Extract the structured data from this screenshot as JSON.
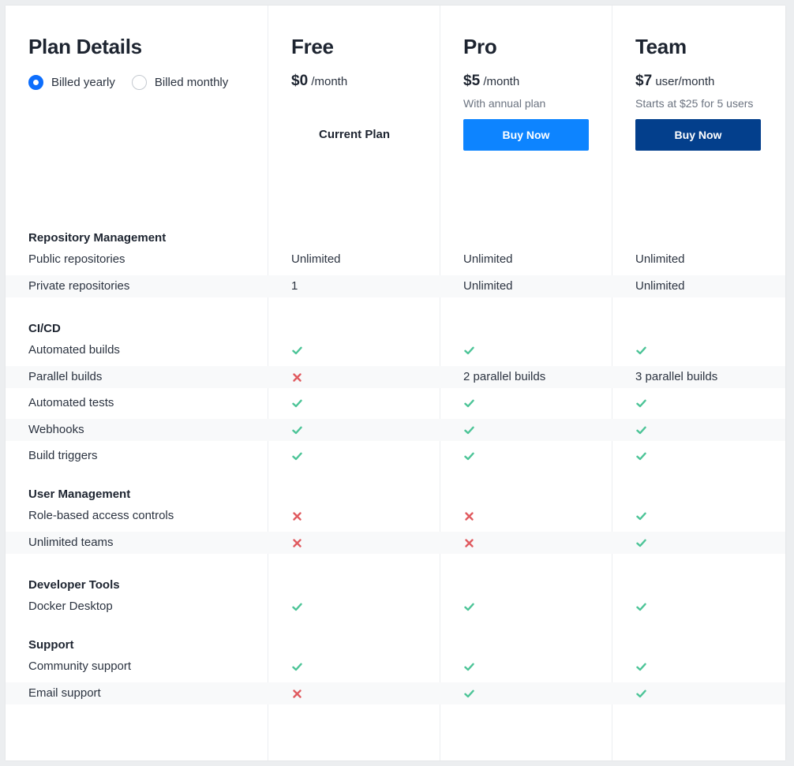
{
  "header": {
    "title": "Plan Details",
    "billing_options": [
      {
        "label": "Billed yearly",
        "selected": true
      },
      {
        "label": "Billed monthly",
        "selected": false
      }
    ]
  },
  "plans": [
    {
      "name": "Free",
      "price": "$0",
      "unit": "/month",
      "note": "",
      "action": "Current Plan",
      "action_type": "text"
    },
    {
      "name": "Pro",
      "price": "$5",
      "unit": "/month",
      "note": "With annual plan",
      "action": "Buy Now",
      "action_type": "button",
      "button_color": "#0d84ff"
    },
    {
      "name": "Team",
      "price": "$7",
      "unit": "user/month",
      "note": "Starts at $25 for 5 users",
      "action": "Buy Now",
      "action_type": "button",
      "button_color": "#033f8c"
    }
  ],
  "icons": {
    "check": {
      "name": "check-icon",
      "color": "#4cc497"
    },
    "cross": {
      "name": "cross-icon",
      "color": "#e05a5f"
    }
  },
  "sections": [
    {
      "title": "Repository Management",
      "rows": [
        {
          "feature": "Public repositories",
          "values": [
            "Unlimited",
            "Unlimited",
            "Unlimited"
          ]
        },
        {
          "feature": "Private repositories",
          "values": [
            "1",
            "Unlimited",
            "Unlimited"
          ]
        }
      ]
    },
    {
      "title": "CI/CD",
      "rows": [
        {
          "feature": "Automated builds",
          "values": [
            "check",
            "check",
            "check"
          ]
        },
        {
          "feature": "Parallel builds",
          "values": [
            "cross",
            "2 parallel builds",
            "3 parallel builds"
          ]
        },
        {
          "feature": "Automated tests",
          "values": [
            "check",
            "check",
            "check"
          ]
        },
        {
          "feature": "Webhooks",
          "values": [
            "check",
            "check",
            "check"
          ]
        },
        {
          "feature": "Build triggers",
          "values": [
            "check",
            "check",
            "check"
          ]
        }
      ]
    },
    {
      "title": "User Management",
      "rows": [
        {
          "feature": "Role-based access controls",
          "values": [
            "cross",
            "cross",
            "check"
          ]
        },
        {
          "feature": "Unlimited teams",
          "values": [
            "cross",
            "cross",
            "check"
          ]
        }
      ]
    },
    {
      "title": "Developer Tools",
      "rows": [
        {
          "feature": "Docker Desktop",
          "values": [
            "check",
            "check",
            "check"
          ]
        }
      ]
    },
    {
      "title": "Support",
      "rows": [
        {
          "feature": "Community support",
          "values": [
            "check",
            "check",
            "check"
          ]
        },
        {
          "feature": "Email support",
          "values": [
            "cross",
            "check",
            "check"
          ]
        }
      ]
    }
  ]
}
